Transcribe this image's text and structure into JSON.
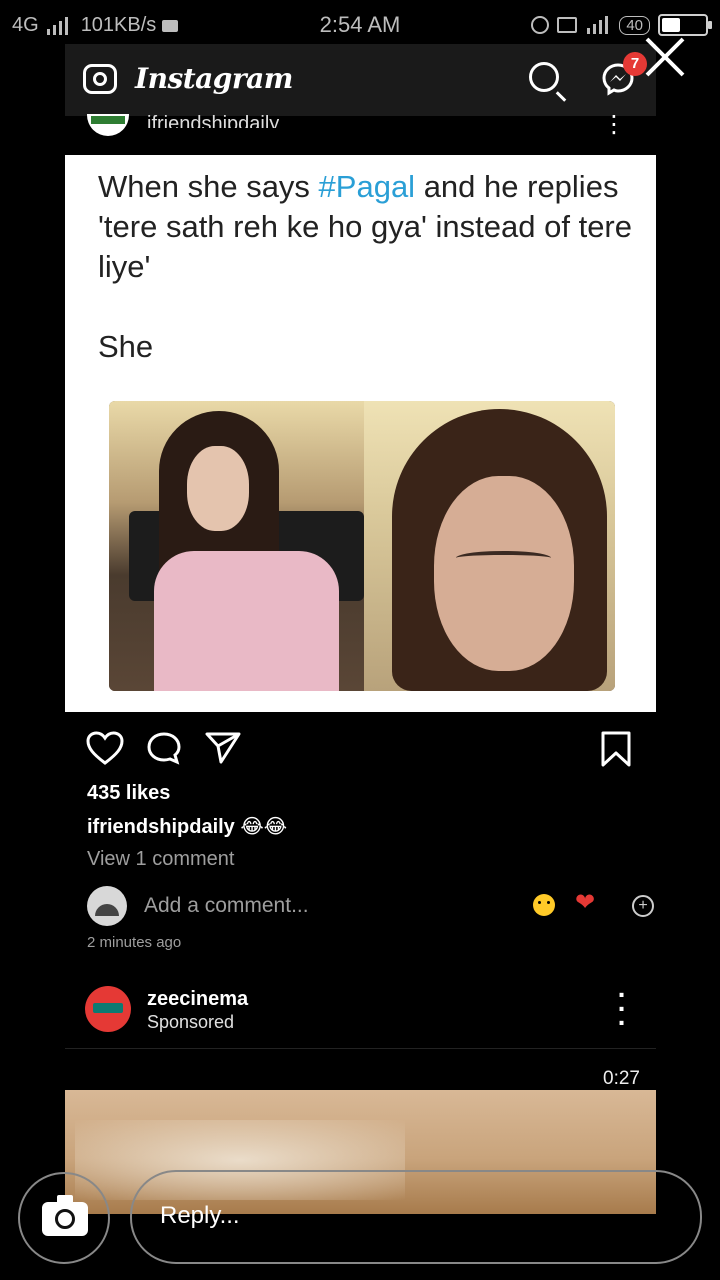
{
  "status_bar": {
    "network_left": "4G",
    "speed_text": "101KB/s",
    "time": "2:54 AM",
    "battery_text": "40",
    "battery_level": 0.4
  },
  "instagram": {
    "header": {
      "logo_text": "Instagram",
      "icons": [
        "camera-icon",
        "search-icon",
        "messenger-icon"
      ],
      "dm_badge": "7"
    },
    "post": {
      "username_top": "ifriendshipdaily",
      "meme_text": {
        "before_tag": "When she says ",
        "hashtag": "#Pagal",
        "after_tag": " and he replies 'tere sath reh ke ho gya' instead of tere liye'",
        "she": "She"
      },
      "likes": "435 likes",
      "caption_user": "ifriendshipdaily",
      "caption_emoji": "😂😂",
      "view_comments": "View 1 comment",
      "add_comment_placeholder": "Add a comment...",
      "time_ago": "2 minutes ago"
    },
    "sponsored": {
      "username": "zeecinema",
      "label": "Sponsored",
      "video_time": "0:27"
    },
    "bottom_nav_icons": [
      "home-icon",
      "reels-icon",
      "add-post-icon",
      "activity-heart-icon",
      "profile-avatar"
    ]
  },
  "overlay": {
    "reply_placeholder": "Reply...",
    "close_icon": "close-icon",
    "camera_icon": "camera-icon"
  },
  "colors": {
    "hashtag": "#2a9fd6",
    "heart_red": "#e53935",
    "badge_red": "#e53935",
    "background": "#000000"
  }
}
